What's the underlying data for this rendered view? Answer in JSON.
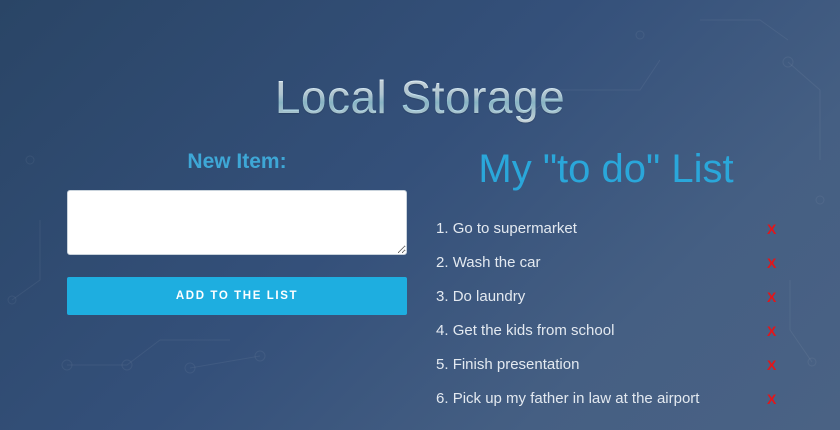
{
  "page": {
    "title": "Local Storage"
  },
  "form": {
    "label": "New Item:",
    "input_value": "",
    "add_button_label": "ADD TO THE LIST"
  },
  "todo": {
    "title": "My \"to do\" List",
    "delete_label": "X",
    "items": [
      {
        "number": "1.",
        "text": "Go to supermarket"
      },
      {
        "number": "2.",
        "text": "Wash the car"
      },
      {
        "number": "3.",
        "text": "Do laundry"
      },
      {
        "number": "4.",
        "text": "Get the kids from school"
      },
      {
        "number": "5.",
        "text": "Finish presentation"
      },
      {
        "number": "6.",
        "text": "Pick up my father in law at the airport"
      }
    ]
  },
  "colors": {
    "accent": "#1eaee0",
    "label": "#3ea7d6",
    "delete": "#e3161a",
    "background_start": "#2a4566",
    "background_end": "#4a6284"
  }
}
